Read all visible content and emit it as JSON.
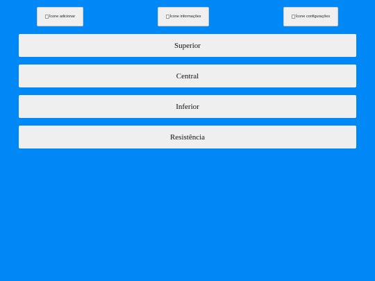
{
  "toolbar": {
    "add": {
      "alt": "Ícone adicionar",
      "icon": "add-icon"
    },
    "info": {
      "alt": "Ícone informações",
      "icon": "info-icon"
    },
    "settings": {
      "alt": "Ícone configurações",
      "icon": "settings-icon"
    }
  },
  "menu": {
    "items": [
      {
        "label": "Superior"
      },
      {
        "label": "Central"
      },
      {
        "label": "Inferior"
      },
      {
        "label": "Resistência"
      }
    ]
  },
  "colors": {
    "background": "#0088f6",
    "button_bg": "#efefef"
  }
}
